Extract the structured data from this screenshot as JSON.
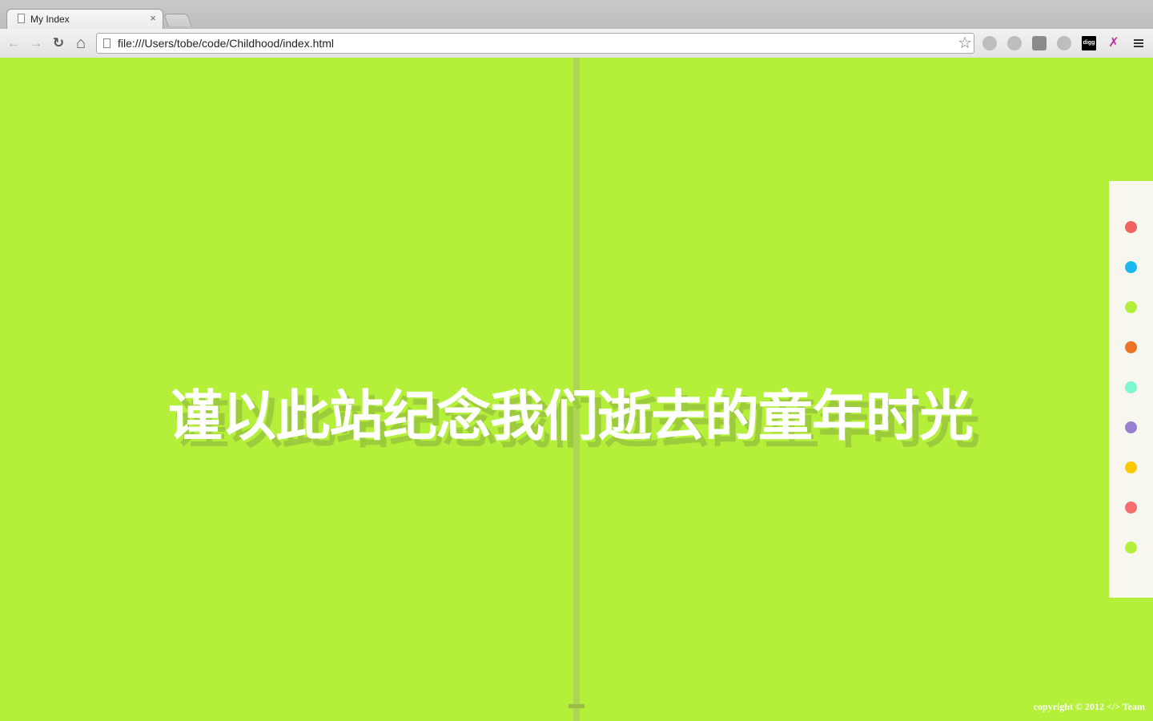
{
  "browser": {
    "tab": {
      "title": "My Index",
      "close_glyph": "×"
    },
    "address": {
      "url": "file:///Users/tobe/code/Childhood/index.html"
    },
    "nav": {
      "back": "←",
      "forward": "→",
      "reload": "↻",
      "home": "⌂"
    },
    "star_glyph": "☆",
    "extensions": [
      {
        "name": "globe-icon"
      },
      {
        "name": "v-icon"
      },
      {
        "name": "bug-icon"
      },
      {
        "name": "download-icon"
      },
      {
        "name": "digg-icon",
        "label": "digg"
      },
      {
        "name": "bow-icon",
        "glyph": "✗"
      },
      {
        "name": "menu-icon"
      }
    ]
  },
  "page": {
    "background": "#b4ef3a",
    "headline": "谨以此站纪念我们逝去的童年时光",
    "copyright": "copyright © 2012 </> Team",
    "nav_dots": [
      {
        "color": "#ef6461"
      },
      {
        "color": "#1ab8ee"
      },
      {
        "color": "#b4ef3a"
      },
      {
        "color": "#ec7224"
      },
      {
        "color": "#7cf7cf"
      },
      {
        "color": "#9a7fd1"
      },
      {
        "color": "#fcc800"
      },
      {
        "color": "#f76d6d"
      },
      {
        "color": "#b4ef3a"
      }
    ]
  }
}
